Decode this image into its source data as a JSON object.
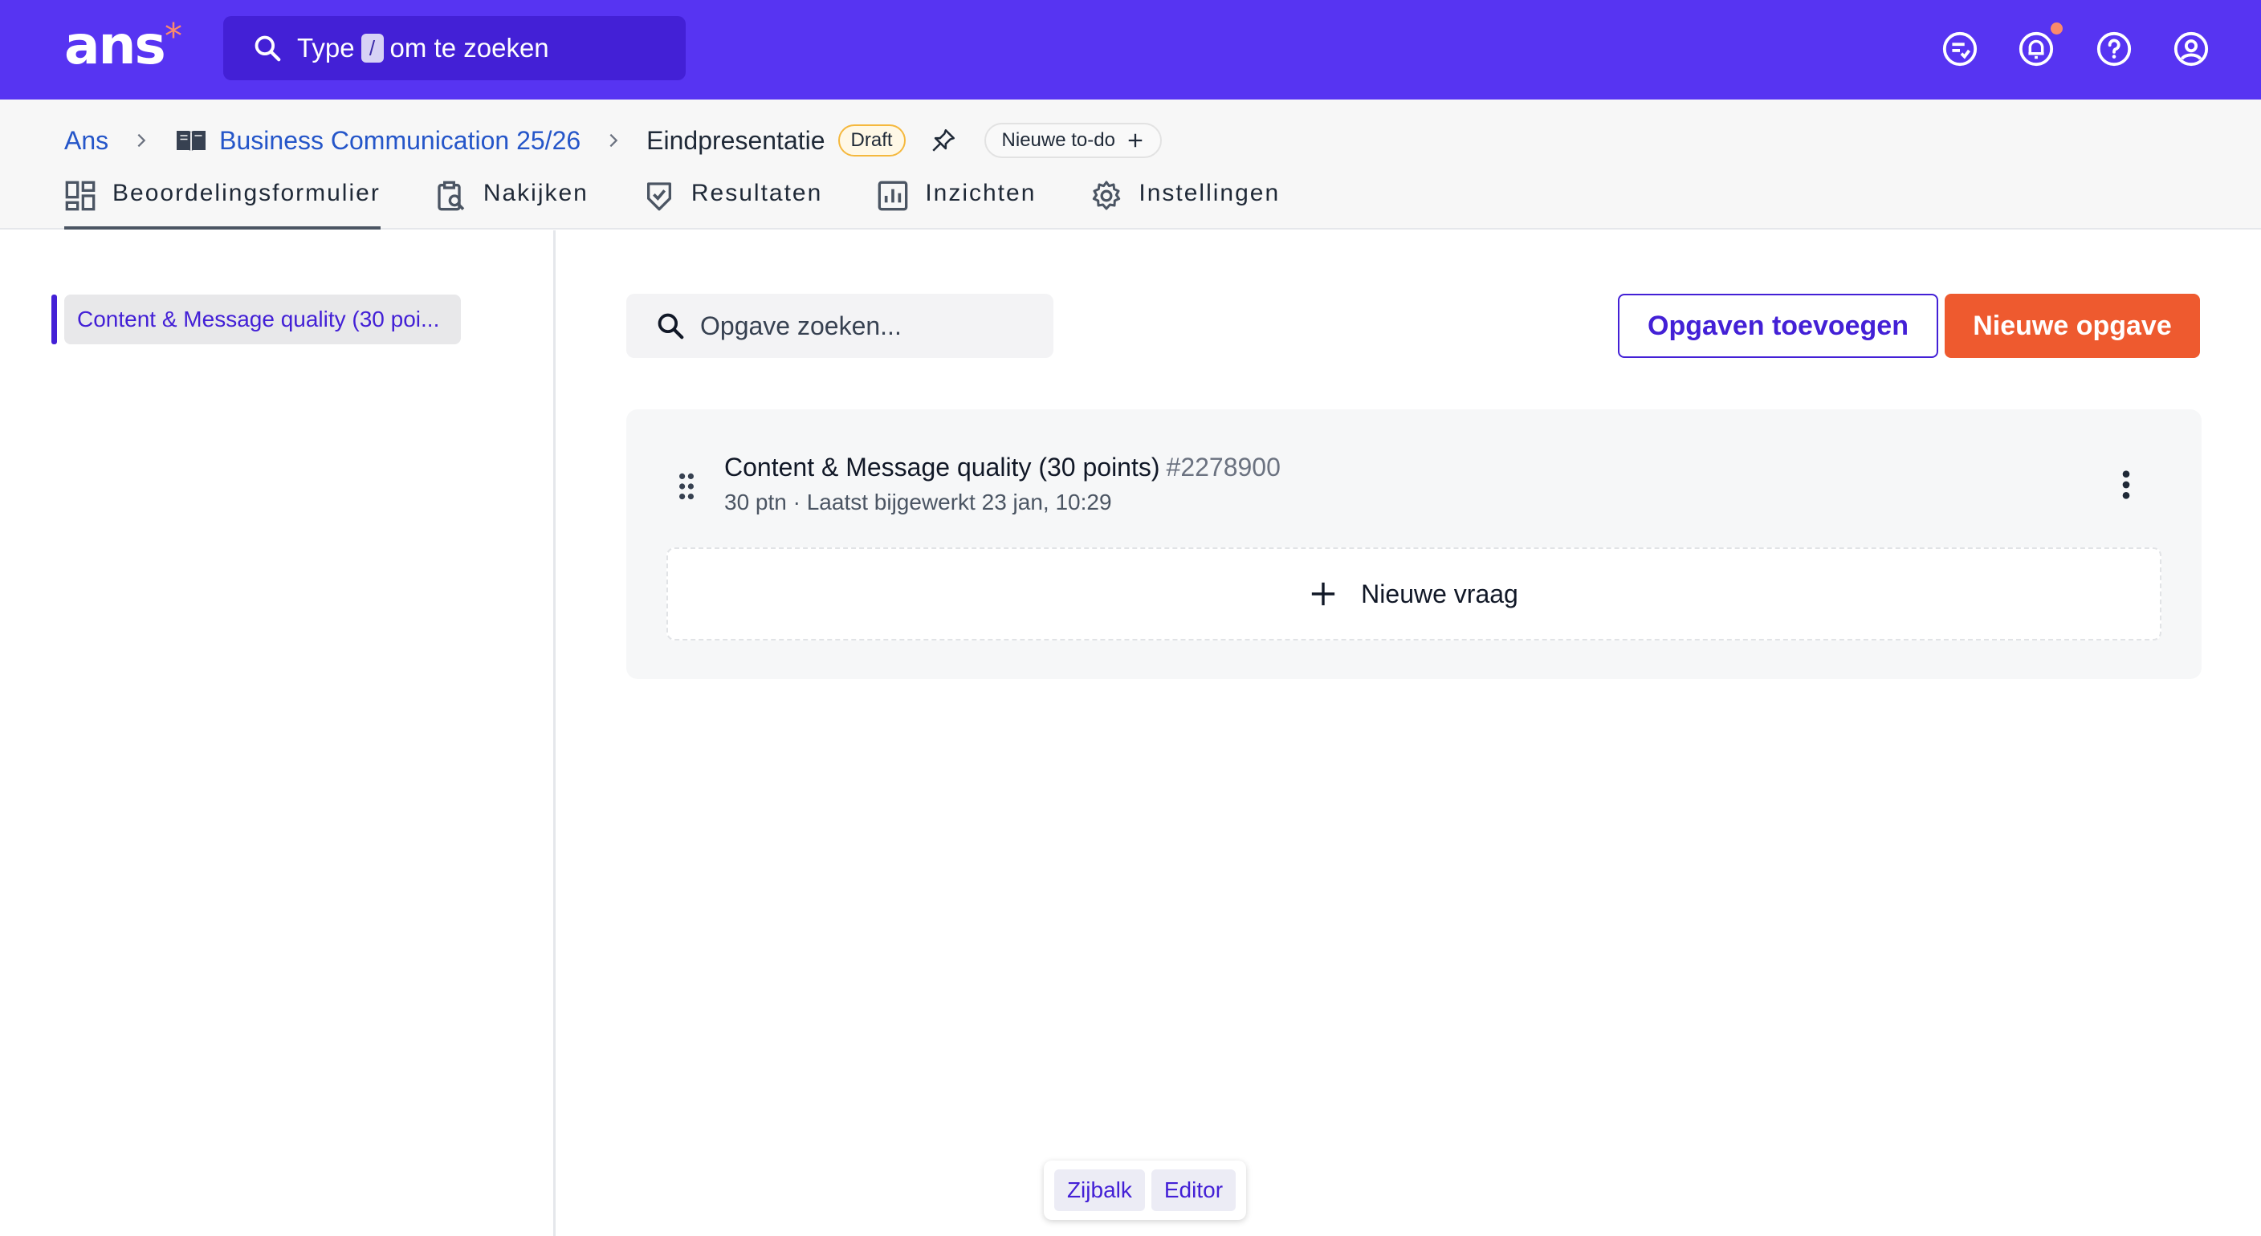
{
  "topbar": {
    "logo": "ans",
    "logo_star": "*",
    "search": {
      "prefix": "Type",
      "key": "/",
      "suffix": "om te zoeken"
    },
    "icons": [
      "todo-list-icon",
      "bell-icon",
      "help-icon",
      "account-icon"
    ],
    "accent": "#5734f2"
  },
  "breadcrumb": {
    "root": "Ans",
    "course": "Business Communication 25/26",
    "current": "Eindpresentatie",
    "badge": "Draft",
    "todo_label": "Nieuwe to-do"
  },
  "tabs": [
    {
      "label": "Beoordelingsformulier",
      "icon": "grid-icon",
      "active": true
    },
    {
      "label": "Nakijken",
      "icon": "clipboard-search-icon",
      "active": false
    },
    {
      "label": "Resultaten",
      "icon": "shield-check-icon",
      "active": false
    },
    {
      "label": "Inzichten",
      "icon": "bar-chart-icon",
      "active": false
    },
    {
      "label": "Instellingen",
      "icon": "gear-icon",
      "active": false
    }
  ],
  "sidebar": {
    "items": [
      {
        "label": "Content & Message quality (30 poi..."
      }
    ]
  },
  "main": {
    "search_placeholder": "Opgave zoeken...",
    "add_tasks_label": "Opgaven toevoegen",
    "new_task_label": "Nieuwe opgave",
    "task": {
      "title": "Content & Message quality (30 points)",
      "id": "#2278900",
      "meta": "30 ptn · Laatst bijgewerkt 23 jan, 10:29"
    },
    "new_question_label": "Nieuwe vraag"
  },
  "view_toggle": {
    "sidebar_label": "Zijbalk",
    "editor_label": "Editor"
  },
  "colors": {
    "primary": "#4320d6",
    "cta": "#ee5a2f",
    "badge_border": "#f5b83d"
  }
}
